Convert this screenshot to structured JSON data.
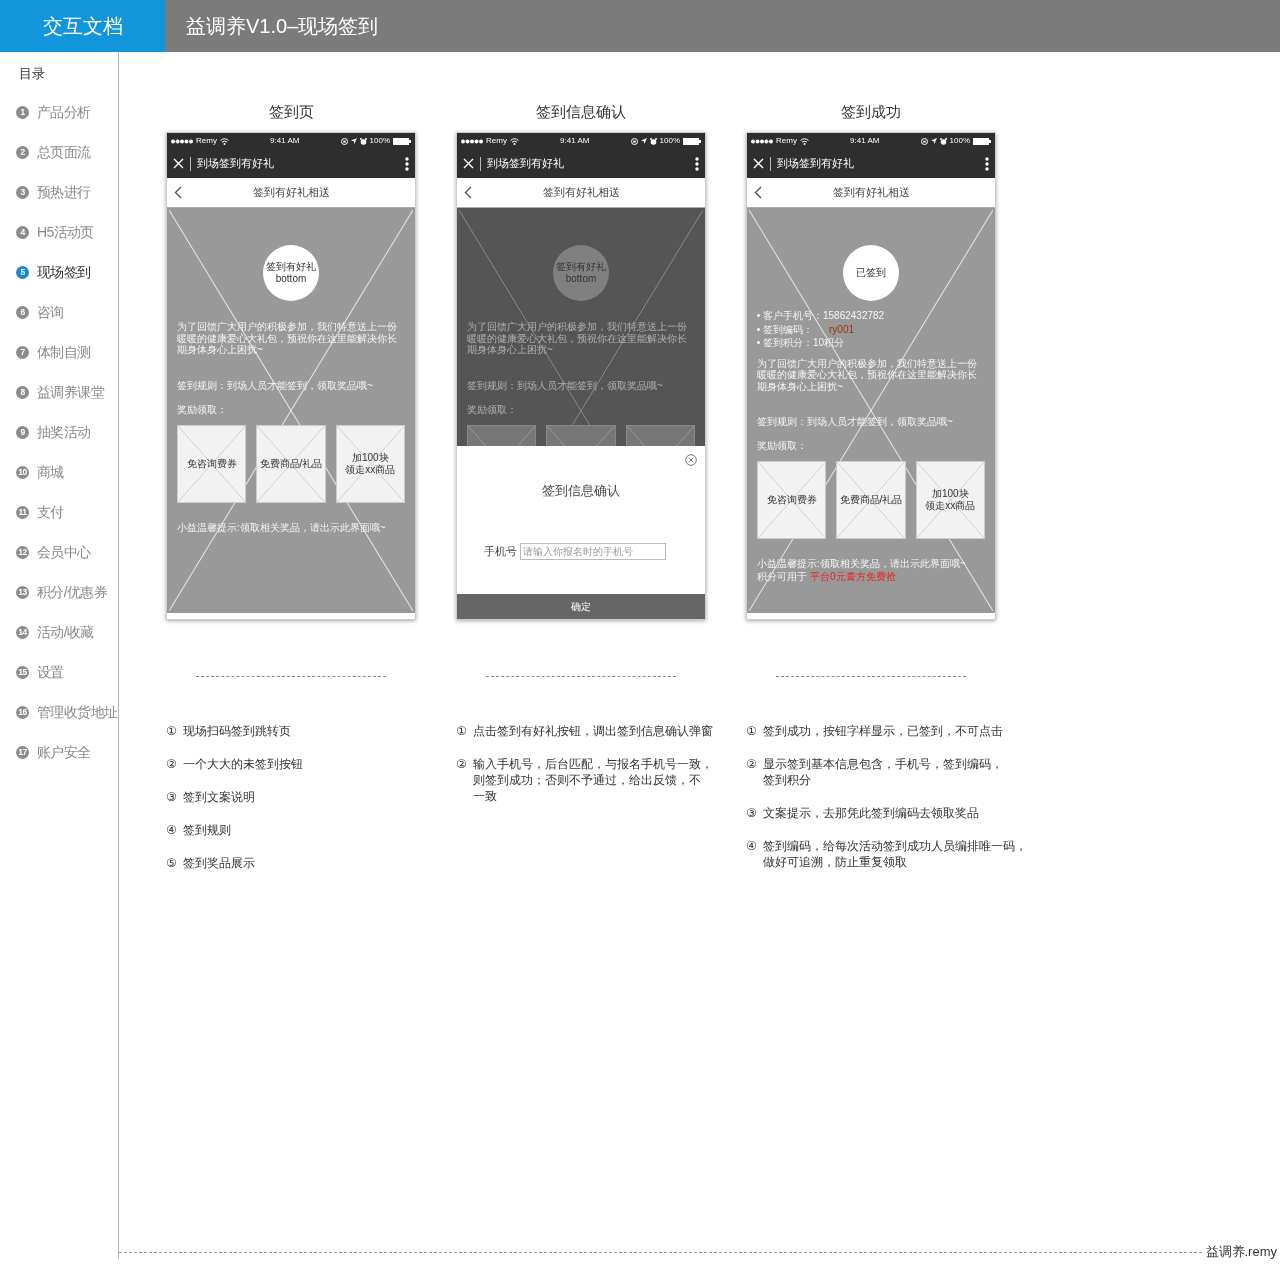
{
  "header": {
    "logo": "交互文档",
    "title": "益调养V1.0–现场签到"
  },
  "sidebar": {
    "heading": "目录",
    "items": [
      {
        "number": "1",
        "label": "产品分析",
        "selected": false
      },
      {
        "number": "2",
        "label": "总页面流",
        "selected": false
      },
      {
        "number": "3",
        "label": "预热进行",
        "selected": false
      },
      {
        "number": "4",
        "label": "H5活动页",
        "selected": false
      },
      {
        "number": "5",
        "label": "现场签到",
        "selected": true
      },
      {
        "number": "6",
        "label": "咨询",
        "selected": false
      },
      {
        "number": "7",
        "label": "体制自测",
        "selected": false
      },
      {
        "number": "8",
        "label": "益调养课堂",
        "selected": false
      },
      {
        "number": "9",
        "label": "抽奖活动",
        "selected": false
      },
      {
        "number": "10",
        "label": "商城",
        "selected": false
      },
      {
        "number": "11",
        "label": "支付",
        "selected": false
      },
      {
        "number": "12",
        "label": "会员中心",
        "selected": false
      },
      {
        "number": "13",
        "label": "积分/优惠券",
        "selected": false
      },
      {
        "number": "14",
        "label": "活动/收藏",
        "selected": false
      },
      {
        "number": "15",
        "label": "设置",
        "selected": false
      },
      {
        "number": "16",
        "label": "管理收货地址",
        "selected": false
      },
      {
        "number": "17",
        "label": "账户安全",
        "selected": false
      }
    ]
  },
  "screens": [
    {
      "caption": "签到页",
      "status_bar": {
        "carrier": "Remy",
        "time": "9:41 AM",
        "battery": "100%"
      },
      "app_bar": {
        "title": "到场签到有好礼"
      },
      "nav_bar": {
        "title": "签到有好礼相送"
      },
      "checkin_button": {
        "lines": [
          "签到有好礼",
          "bottom"
        ]
      },
      "intro": "为了回馈广大用户的积极参加，我们特意送上一份暖暖的健康爱心大礼包，预祝你在这里能解决你长期身体身心上困扰~",
      "rule": "签到规则：到场人员才能签到，领取奖品哦~",
      "reward_label": "奖励领取：",
      "rewards": [
        {
          "kind": "labeled",
          "lines": [
            "免咨询费券"
          ]
        },
        {
          "kind": "labeled",
          "lines": [
            "免费商品/礼品"
          ]
        },
        {
          "kind": "labeled",
          "lines": [
            "加100块",
            "领走xx商品"
          ]
        }
      ],
      "tips": [
        {
          "text": "小益温馨提示:领取相关奖品，请出示此界面哦~"
        }
      ],
      "dimmed": false
    },
    {
      "caption": "签到信息确认",
      "status_bar": {
        "carrier": "Remy",
        "time": "9:41 AM",
        "battery": "100%"
      },
      "app_bar": {
        "title": "到场签到有好礼"
      },
      "nav_bar": {
        "title": "签到有好礼相送"
      },
      "checkin_button": {
        "lines": [
          "签到有好礼",
          "bottom"
        ]
      },
      "intro": "为了回馈广大用户的积极参加，我们特意送上一份暖暖的健康爱心大礼包，预祝你在这里能解决你长期身体身心上困扰~",
      "rule": "签到规则：到场人员才能签到，领取奖品哦~",
      "reward_label": "奖励领取：",
      "rewards": [
        {
          "kind": "blank"
        },
        {
          "kind": "blank"
        },
        {
          "kind": "blank"
        }
      ],
      "dimmed": true,
      "modal": {
        "title": "签到信息确认",
        "field_label": "手机号",
        "placeholder": "请输入你报名时的手机号",
        "confirm": "确定"
      }
    },
    {
      "caption": "签到成功",
      "status_bar": {
        "carrier": "Remy",
        "time": "9:41 AM",
        "battery": "100%"
      },
      "app_bar": {
        "title": "到场签到有好礼"
      },
      "nav_bar": {
        "title": "签到有好礼相送"
      },
      "checkin_button": {
        "lines": [
          "已签到"
        ]
      },
      "info": [
        {
          "label": "客户手机号：",
          "value": "15862432782",
          "kind": "plain"
        },
        {
          "label": "签到编码：",
          "value": "ry001",
          "kind": "code"
        },
        {
          "label": "签到积分：",
          "value": "10积分",
          "kind": "plain"
        }
      ],
      "intro": "为了回馈广大用户的积极参加，我们特意送上一份暖暖的健康爱心大礼包，预祝你在这里能解决你长期身体身心上困扰~",
      "rule": "签到规则：到场人员才能签到，领取奖品哦~",
      "reward_label": "奖励领取：",
      "rewards": [
        {
          "kind": "labeled",
          "lines": [
            "免咨询费券"
          ]
        },
        {
          "kind": "labeled",
          "lines": [
            "免费商品/礼品"
          ]
        },
        {
          "kind": "labeled",
          "lines": [
            "加100块",
            "领走xx商品"
          ]
        }
      ],
      "tips": [
        {
          "text": "小益温馨提示:领取相关奖品，请出示此界面哦~"
        },
        {
          "text": "积分可用于",
          "highlight": "平台0元膏方免费抢"
        }
      ],
      "dimmed": false
    }
  ],
  "notes": [
    {
      "items": [
        {
          "number": "①",
          "lines": [
            "现场扫码签到跳转页"
          ]
        },
        {
          "number": "②",
          "lines": [
            "一个大大的未签到按钮"
          ]
        },
        {
          "number": "③",
          "lines": [
            "签到文案说明"
          ]
        },
        {
          "number": "④",
          "lines": [
            "签到规则"
          ]
        },
        {
          "number": "⑤",
          "lines": [
            "签到奖品展示"
          ]
        }
      ]
    },
    {
      "items": [
        {
          "number": "①",
          "lines": [
            "点击签到有好礼按钮，调出签到信息确认弹窗"
          ]
        },
        {
          "number": "②",
          "lines": [
            "输入手机号，后台匹配，与报名手机号一致，",
            "则签到成功；否则不予通过，给出反馈，不",
            "一致"
          ]
        }
      ]
    },
    {
      "items": [
        {
          "number": "①",
          "lines": [
            "签到成功，按钮字样显示，已签到，不可点击"
          ]
        },
        {
          "number": "②",
          "lines": [
            "显示签到基本信息包含，手机号，签到编码，",
            "签到积分"
          ]
        },
        {
          "number": "③",
          "lines": [
            "文案提示，去那凭此签到编码去领取奖品"
          ]
        },
        {
          "number": "④",
          "lines": [
            "签到编码，给每次活动签到成功人员编排唯一码，",
            "做好可追溯，防止重复领取"
          ]
        }
      ]
    }
  ],
  "footer": "益调养.remy"
}
